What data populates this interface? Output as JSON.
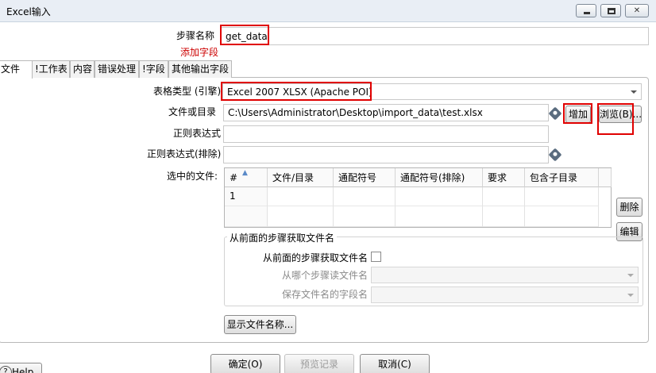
{
  "window": {
    "title": "Excel输入"
  },
  "step": {
    "name_label": "步骤名称",
    "name_value": "get_data",
    "add_field_link": "添加字段"
  },
  "tabs": [
    "文件",
    "!工作表",
    "内容",
    "错误处理",
    "!字段",
    "其他输出字段"
  ],
  "form": {
    "spreadsheet_type_label": "表格类型 (引擎)",
    "spreadsheet_type_value": "Excel 2007 XLSX (Apache POI)",
    "file_label": "文件或目录",
    "file_value": "C:\\Users\\Administrator\\Desktop\\import_data\\test.xlsx",
    "add_button": "增加",
    "browse_button": "浏览(B)...",
    "regex_label": "正则表达式",
    "regex_exclude_label": "正则表达式(排除)",
    "selected_files_label": "选中的文件:"
  },
  "files_table": {
    "columns": [
      "#",
      "文件/目录",
      "通配符号",
      "通配符号(排除)",
      "要求",
      "包含子目录"
    ],
    "rows": [
      [
        "1",
        "",
        "",
        "",
        "",
        ""
      ]
    ]
  },
  "side_buttons": {
    "delete": "删除",
    "edit": "编辑"
  },
  "from_previous": {
    "group_title": "从前面的步骤获取文件名",
    "checkbox_label": "从前面的步骤获取文件名",
    "step_label": "从哪个步骤读文件名",
    "field_label": "保存文件名的字段名"
  },
  "show_filenames_button": "显示文件名称...",
  "footer": {
    "ok": "确定(O)",
    "preview": "预览记录",
    "cancel": "取消(C)",
    "help": "Help"
  }
}
